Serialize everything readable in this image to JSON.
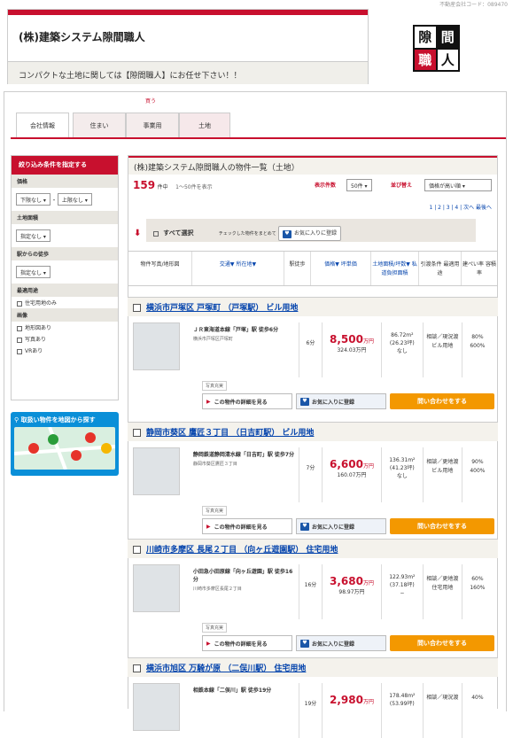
{
  "site_code": "不動産会社コード：089470",
  "company_name": "(株)建築システム隙間職人",
  "slogan": "コンパクトな土地に関しては【隙間職人】にお任せ下さい！！",
  "logo_chars": [
    "隙",
    "間",
    "職",
    "人"
  ],
  "tabs_caption": "買う",
  "tabs": [
    "会社情報",
    "住まい",
    "事業用",
    "土地"
  ],
  "sidebar": {
    "title": "絞り込み条件を指定する",
    "price_label": "価格",
    "price_min": "下限なし",
    "price_max": "上限なし",
    "area_label": "土地面積",
    "area_value": "指定なし",
    "walk_label": "駅からの徒歩",
    "walk_value": "指定なし",
    "use_label": "最適用途",
    "use_opt": "住宅用地のみ",
    "img_label": "画像",
    "img_opts": [
      "地形図あり",
      "写真あり",
      "VRあり"
    ]
  },
  "map_button": "取扱い物件を地図から探す",
  "list_title": "(株)建築システム隙間職人の物件一覧（土地）",
  "total": "159",
  "total_unit": "件中",
  "range": "1〜50件を表示",
  "per_page_label": "表示件数",
  "per_page": "50件",
  "sort_label": "並び替え",
  "sort": "価格が高い順",
  "pager": "1 | 2 | 3 | 4 | 次へ 最後へ",
  "select_all": "すべて選択",
  "select_note": "チェックした物件をまとめて",
  "fav": "お気に入りに登録",
  "detail": "この物件の詳細を見る",
  "inquiry": "問い合わせをする",
  "photo_badge": "写真充実",
  "headers": [
    "物件写真/地形図",
    "交通▼ 所在地▼",
    "駅徒歩",
    "価格▼ 坪単価",
    "土地面積/坪数▼ 私道負担面積",
    "引渡条件 最適用途",
    "建ぺい率 容積率"
  ],
  "props": [
    {
      "title": "横浜市戸塚区 戸塚町 （戸塚駅） ビル用地",
      "station": "ＪＲ東海道本線「戸塚」駅 徒歩6分",
      "addr": "横浜市戸塚区戸塚町",
      "walk": "6分",
      "price": "8,500",
      "unit": "万円",
      "tsubo": "324.03万円",
      "area": "86.72m²",
      "tsubo_area": "(26.23坪)",
      "private": "なし",
      "cond": "相談／現況渡",
      "use": "ビル用地",
      "bc": "80%",
      "fa": "600%"
    },
    {
      "title": "静岡市葵区 鷹匠３丁目 （日吉町駅） ビル用地",
      "station": "静岡鉄道静岡清水線「日吉町」駅 徒歩7分",
      "addr": "静岡市葵区鷹匠３丁目",
      "walk": "7分",
      "price": "6,600",
      "unit": "万円",
      "tsubo": "160.07万円",
      "area": "136.31m²",
      "tsubo_area": "(41.23坪)",
      "private": "なし",
      "cond": "相談／更地渡",
      "use": "ビル用地",
      "bc": "90%",
      "fa": "400%"
    },
    {
      "title": "川崎市多摩区 長尾２丁目 （向ヶ丘遊園駅） 住宅用地",
      "station": "小田急小田原線「向ヶ丘遊園」駅 徒歩16分",
      "addr": "川崎市多摩区長尾２丁目",
      "walk": "16分",
      "price": "3,680",
      "unit": "万円",
      "tsubo": "98.97万円",
      "area": "122.93m²",
      "tsubo_area": "(37.18坪)",
      "private": "−",
      "cond": "相談／更地渡",
      "use": "住宅用地",
      "bc": "60%",
      "fa": "160%"
    },
    {
      "title": "横浜市旭区 万騎が原 （二俣川駅） 住宅用地",
      "station": "相鉄本線「二俣川」駅 徒歩19分",
      "addr": "",
      "walk": "19分",
      "price": "2,980",
      "unit": "万円",
      "tsubo": "",
      "area": "178.48m²",
      "tsubo_area": "(53.99坪)",
      "private": "",
      "cond": "相談／現況渡",
      "use": "",
      "bc": "40%",
      "fa": ""
    }
  ]
}
